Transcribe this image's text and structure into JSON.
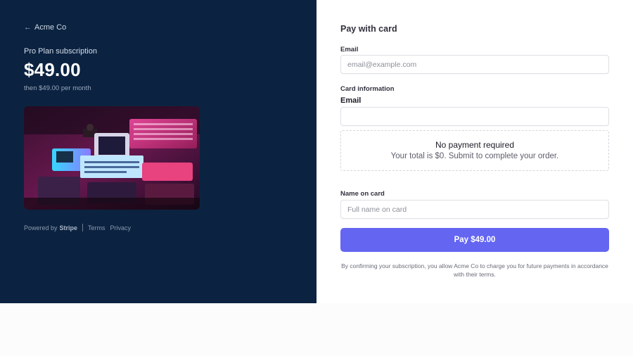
{
  "summary": {
    "back_icon": "←",
    "merchant": "Acme Co",
    "plan_name": "Pro Plan subscription",
    "price": "$49.00",
    "price_note": "then $49.00 per month",
    "product_image": "retro-computers-neon-photo"
  },
  "footer": {
    "powered_by": "Powered by",
    "brand": "Stripe",
    "terms": "Terms",
    "privacy": "Privacy"
  },
  "form": {
    "title": "Pay with card",
    "email_label": "Email",
    "email_placeholder": "email@example.com",
    "card_section_label": "Card information",
    "card_email_label": "Email",
    "card_email_value": "",
    "no_payment_title": "No payment required",
    "no_payment_text": "Your total is $0. Submit to complete your order.",
    "name_label": "Name on card",
    "name_placeholder": "Full name on card",
    "pay_button": "Pay $49.00",
    "terms_text": "By confirming your subscription, you allow Acme Co to charge you for future payments in accordance with their terms."
  },
  "colors": {
    "left_panel_bg": "#0b2341",
    "pay_button_bg": "#6466f1"
  }
}
